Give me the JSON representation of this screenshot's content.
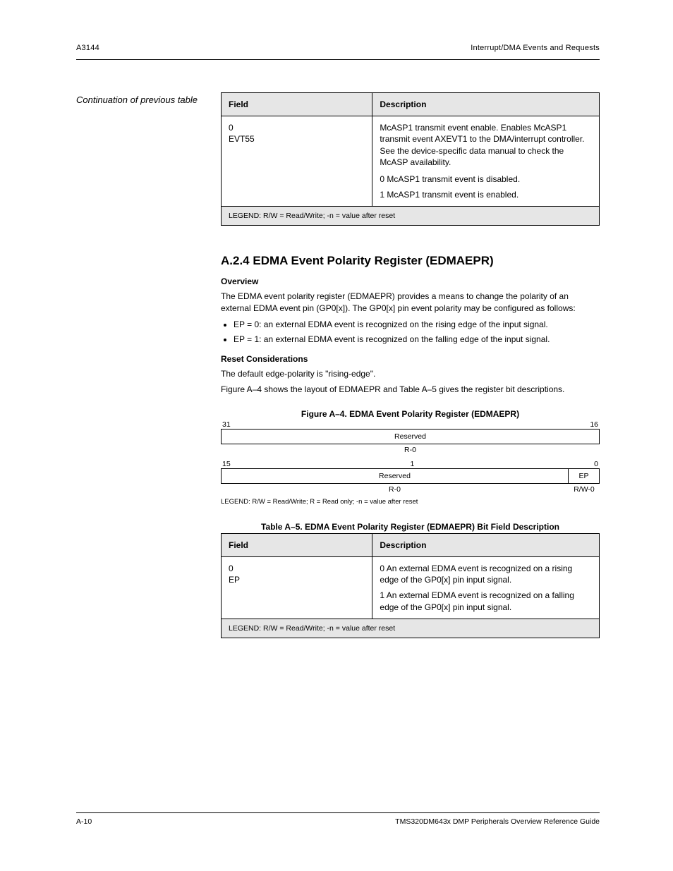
{
  "header": {
    "left": "A3144",
    "right": "Interrupt/DMA Events and Requests"
  },
  "table1": {
    "side_label": "Continuation of previous table",
    "h1": "Field",
    "h2": "Description",
    "r_field": "0\nEVT55",
    "r_desc_main": "McASP1 transmit event enable. Enables McASP1 transmit event AXEVT1 to the DMA/interrupt controller. See the device-specific data manual to check the McASP availability.",
    "r_opt0": "0    McASP1 transmit event is disabled.",
    "r_opt1": "1    McASP1 transmit event is enabled.",
    "foot": "LEGEND: R/W = Read/Write; -n = value after reset"
  },
  "section": {
    "num_title": "A.2.4    EDMA Event Polarity Register (EDMAEPR)",
    "s1": "Overview",
    "s1p": "The EDMA event polarity register (EDMAEPR) provides a means to change the polarity of an external EDMA event pin (GP0[x]). The GP0[x] pin event polarity may be configured as follows:",
    "s1b1": "EP = 0: an external EDMA event is recognized on the rising edge of the input signal.",
    "s1b2": "EP = 1: an external EDMA event is recognized on the falling edge of the input signal.",
    "s2": "Reset Considerations",
    "s2p": "The default edge-polarity is \"rising-edge\".",
    "tcap_a": "Figure A–4 shows the layout of EDMAEPR and Table A–5 gives the register bit descriptions.",
    "fig_label": "Figure A–4.  EDMA Event Polarity Register (EDMAEPR)"
  },
  "regfig": {
    "bits_hi": [
      "31",
      "16"
    ],
    "row_hi": "Reserved",
    "row_hi_rw": "R-0",
    "bits_lo": [
      "15",
      "1",
      "0"
    ],
    "row_lo_left": "Reserved",
    "row_lo_right": "EP",
    "row_lo_rw_left": "R-0",
    "row_lo_rw_right": "R/W-0",
    "legend": "LEGEND: R/W = Read/Write; R = Read only; -n = value after reset"
  },
  "table2": {
    "caption": "Table A–5.  EDMA Event Polarity Register (EDMAEPR) Bit Field Description",
    "h1": "Field",
    "h2": "Description",
    "r_field": "0\nEP",
    "r_desc0": "0    An external EDMA event is recognized on a rising edge of the GP0[x] pin input signal.",
    "r_desc1": "1    An external EDMA event is recognized on a falling edge of the GP0[x] pin input signal.",
    "foot": "LEGEND: R/W = Read/Write; -n = value after reset"
  },
  "footer": {
    "left": "A-10",
    "right": "TMS320DM643x DMP Peripherals Overview Reference Guide"
  }
}
